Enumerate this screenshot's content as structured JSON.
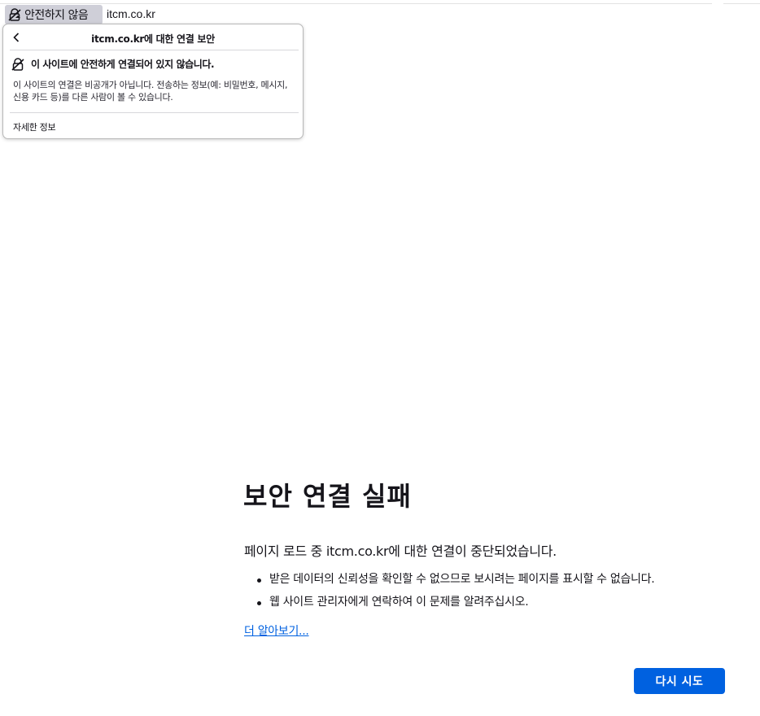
{
  "urlbar": {
    "identity_label": "안전하지 않음",
    "url": "itcm.co.kr",
    "identity_icon": "insecure-lock-icon"
  },
  "security_panel": {
    "title": "itcm.co.kr에 대한 연결 보안",
    "back_icon": "chevron-left-icon",
    "status_icon": "insecure-lock-icon",
    "status_text": "이 사이트에 안전하게 연결되어 있지 않습니다.",
    "description": "이 사이트의 연결은 비공개가 아닙니다. 전송하는 정보(예: 비밀번호, 메시지, 신용 카드 등)를 다른 사람이 볼 수 있습니다.",
    "more_info": "자세한 정보"
  },
  "error_page": {
    "title": "보안 연결 실패",
    "description": "페이지 로드 중 itcm.co.kr에 대한 연결이 중단되었습니다.",
    "bullets": [
      "받은 데이터의 신뢰성을 확인할 수 없으므로 보시려는 페이지를 표시할 수 없습니다.",
      "웹 사이트 관리자에게 연락하여 이 문제를 알려주십시오."
    ],
    "learn_more": "더 알아보기...",
    "retry_button": "다시 시도"
  },
  "colors": {
    "accent": "#0061e0",
    "identity_bg": "#cfcfd8"
  }
}
